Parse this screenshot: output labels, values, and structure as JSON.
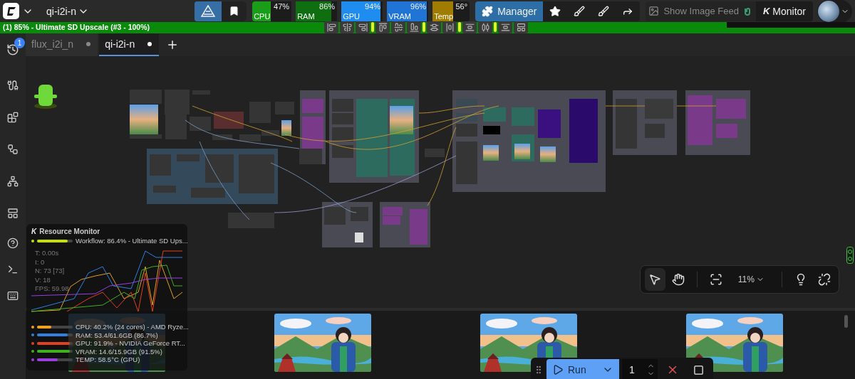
{
  "topbar": {
    "workflow_name": "qi-i2i-n",
    "meters": [
      {
        "label": "CPU",
        "value": "47%",
        "level": 0.47,
        "color": "#1a9e1a"
      },
      {
        "label": "RAM",
        "value": "86%",
        "level": 0.86,
        "color": "#0f6e10"
      },
      {
        "label": "GPU",
        "value": "94%",
        "level": 0.94,
        "color": "#1f8cf0"
      },
      {
        "label": "VRAM",
        "value": "96%",
        "level": 0.96,
        "color": "#1f74d6"
      },
      {
        "label": "Temp",
        "value": "56°",
        "level": 0.56,
        "color": "#a07c00"
      }
    ],
    "manager_label": "Manager",
    "image_feed_label": "Show Image Feed",
    "monitor_badge": "K",
    "monitor_label": "Monitor"
  },
  "progress": {
    "text": "(1) 85% - Ultimate SD Upscale (#3 - 100%)",
    "level": 0.85
  },
  "node_progress": {
    "level": 1
  },
  "tabs": {
    "queue_badge": "1",
    "items": [
      {
        "label": "flux_i2i_n",
        "selected": false
      },
      {
        "label": "qi-i2i-n",
        "selected": true
      }
    ]
  },
  "canvas_toolbar": {
    "tools": [
      {
        "kind": "select",
        "selected": true
      },
      {
        "kind": "pan",
        "selected": false
      }
    ],
    "zoom": "11%"
  },
  "resource_monitor": {
    "badge": "K",
    "title": "Resource Monitor",
    "workflow": {
      "text": "Workflow: 86.4% - Ultimate SD Ups...",
      "level": 0.864,
      "color": "#c6e000"
    },
    "stats": [
      "T: 0.00s",
      "I: 0",
      "N: 73 [73]",
      "V: 18",
      "FPS: 59.98"
    ],
    "rows": [
      {
        "text": "CPU: 40.2% (24 cores) - AMD Ryze...",
        "level": 0.402,
        "color": "#f0a020"
      },
      {
        "text": "RAM: 53.4/61.6GB (86.7%)",
        "level": 0.867,
        "color": "#2f80e0"
      },
      {
        "text": "GPU: 91.9% - NVIDIA GeForce RT...",
        "level": 0.919,
        "color": "#e0401c"
      },
      {
        "text": "VRAM: 14.6/15.9GB (91.5%)",
        "level": 0.915,
        "color": "#40b020"
      },
      {
        "text": "TEMP: 58.5°C (GPU)",
        "level": 0.585,
        "color": "#9a3ee0"
      }
    ]
  },
  "run_bar": {
    "run_label": "Run",
    "count": "1"
  }
}
